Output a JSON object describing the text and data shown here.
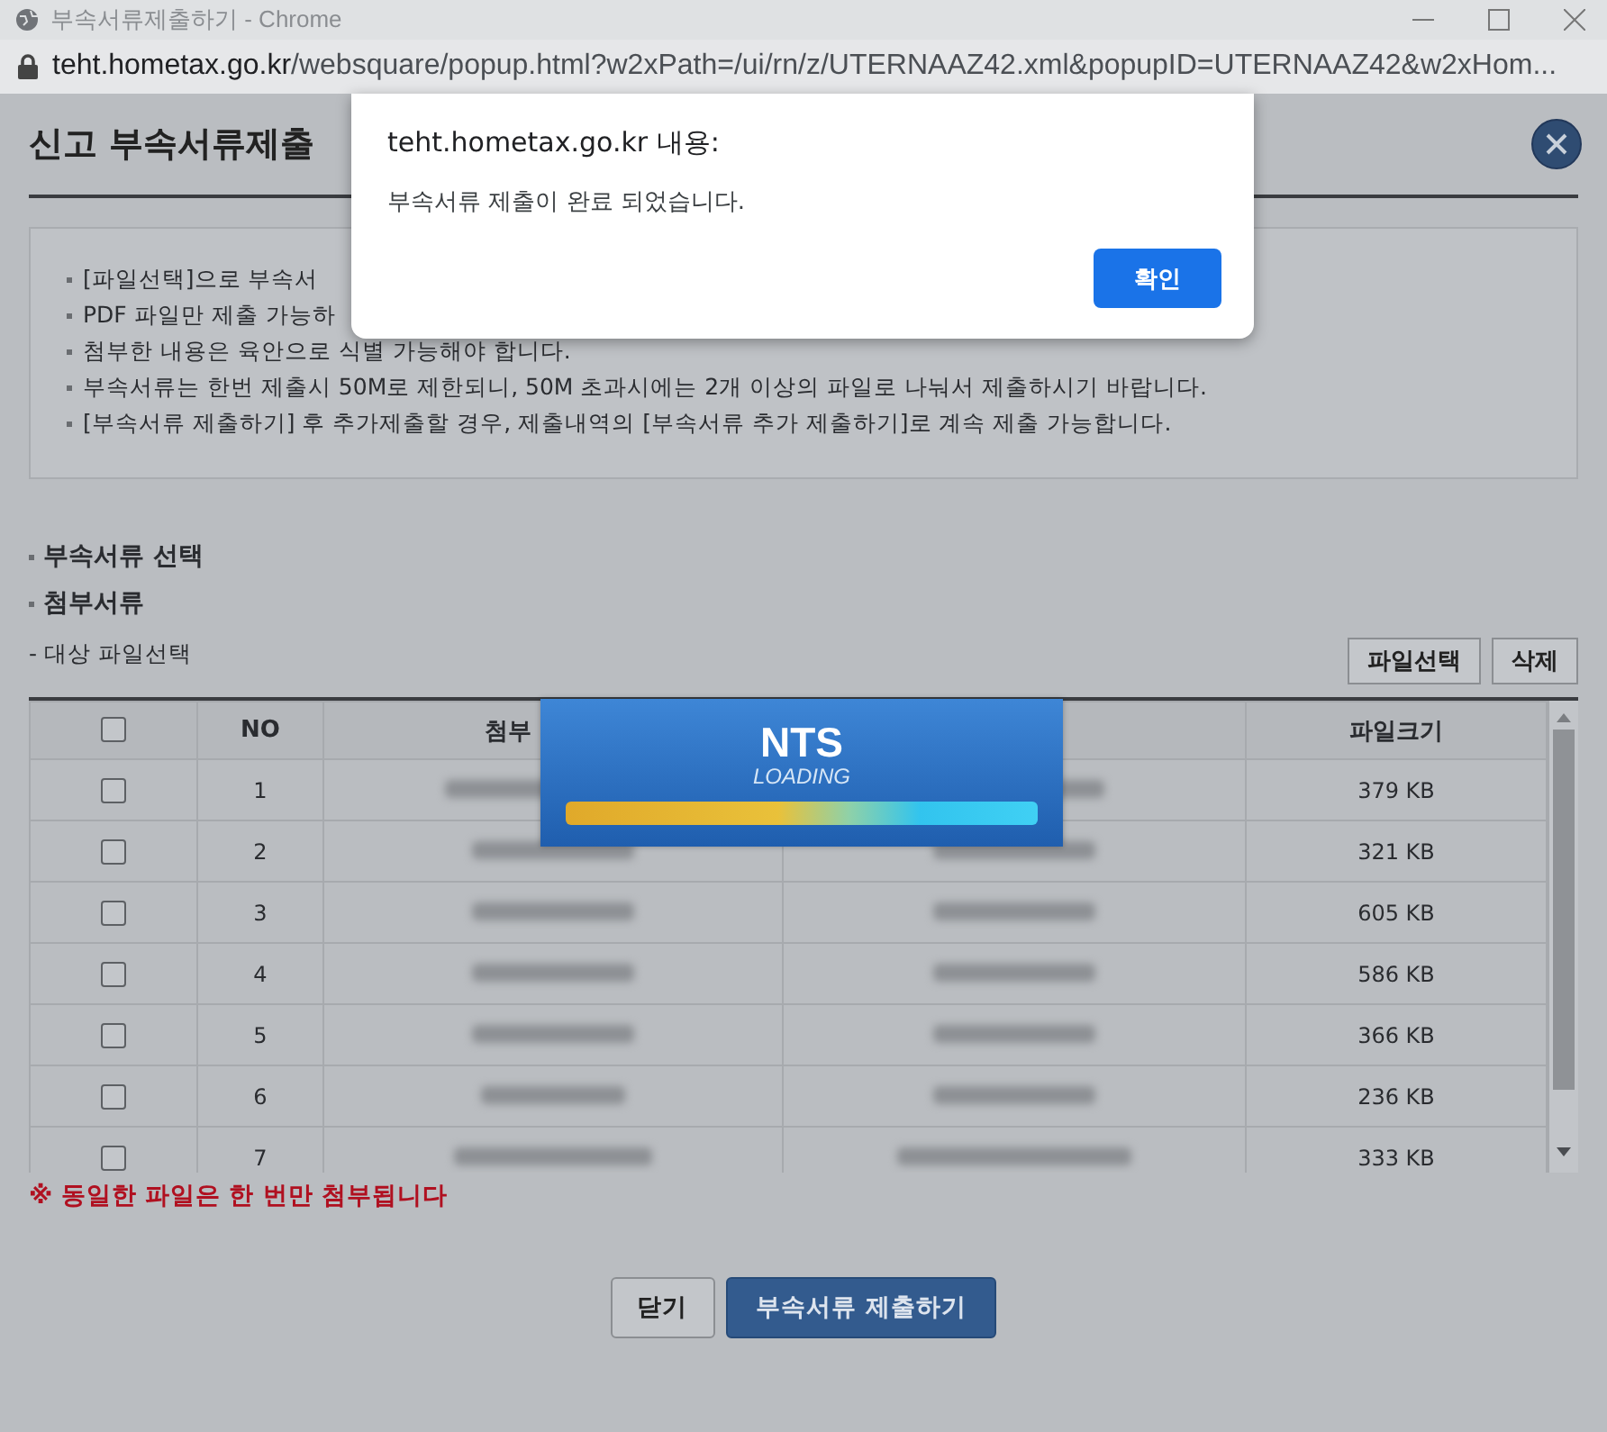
{
  "browser": {
    "title": "부속서류제출하기 - Chrome",
    "url_host": "teht.hometax.go.kr",
    "url_path": "/websquare/popup.html?w2xPath=/ui/rn/z/UTERNAAZ42.xml&popupID=UTERNAAZ42&w2xHom..."
  },
  "popup": {
    "title": "신고 부속서류제출",
    "notes": [
      "[파일선택]으로 부속서",
      "PDF 파일만 제출 가능하",
      "첨부한 내용은 육안으로 식별 가능해야 합니다.",
      "부속서류는 한번 제출시 50M로 제한되니, 50M 초과시에는 2개 이상의 파일로 나눠서 제출하시기 바랍니다.",
      "[부속서류 제출하기] 후 추가제출할 경우, 제출내역의 [부속서류 추가 제출하기]로 계속 제출 가능합니다."
    ],
    "sections": [
      "부속서류 선택",
      "첨부서류"
    ],
    "file_label": "- 대상 파일선택",
    "toolbar_buttons": [
      "파일선택",
      "삭제"
    ],
    "table": {
      "select_all_checked": false,
      "columns": [
        "NO",
        "첨부",
        "파일크기"
      ],
      "rows": [
        {
          "no": "1",
          "checked": false,
          "size": "379 KB"
        },
        {
          "no": "2",
          "checked": false,
          "size": "321 KB"
        },
        {
          "no": "3",
          "checked": false,
          "size": "605 KB"
        },
        {
          "no": "4",
          "checked": false,
          "size": "586 KB"
        },
        {
          "no": "5",
          "checked": false,
          "size": "366 KB"
        },
        {
          "no": "6",
          "checked": false,
          "size": "236 KB"
        },
        {
          "no": "7",
          "checked": false,
          "size": "333 KB"
        }
      ]
    },
    "warning": "※ 동일한 파일은 한 번만 첨부됩니다",
    "buttons": [
      {
        "label": "닫기",
        "kind": "secondary"
      },
      {
        "label": "부속서류 제출하기",
        "kind": "primary"
      }
    ]
  },
  "alert": {
    "title": "teht.hometax.go.kr 내용:",
    "message": "부속서류 제출이 완료 되었습니다.",
    "button": "확인"
  },
  "loading": {
    "title": "NTS",
    "subtitle": "LOADING"
  }
}
